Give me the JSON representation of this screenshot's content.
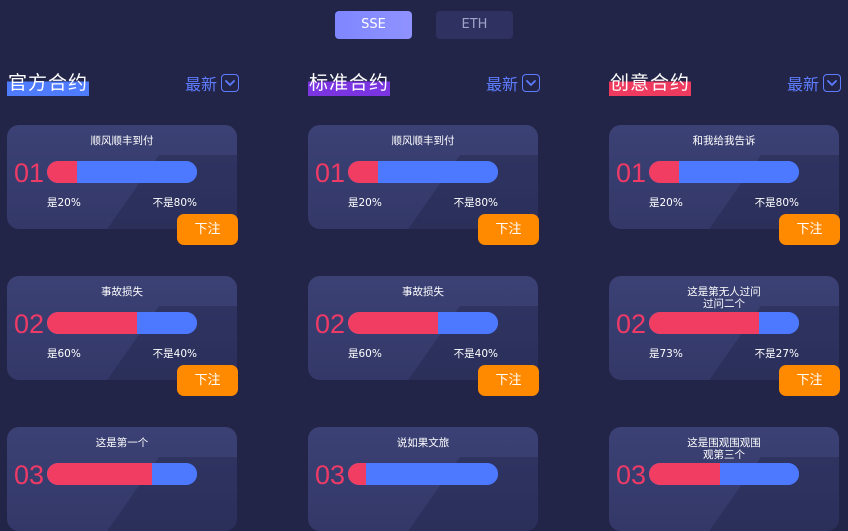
{
  "tabs": [
    {
      "label": "SSE",
      "active": true
    },
    {
      "label": "ETH",
      "active": false
    }
  ],
  "colors": {
    "background": "#232548",
    "tab_active": "#8289ff",
    "accent_blue": "#5d7cff",
    "yes_red": "#f23d63",
    "no_blue": "#4c79ff",
    "button_orange": "#ff8a00",
    "number_pink": "#ee3a66"
  },
  "columns": [
    {
      "title": "官方合约",
      "sort_label": "最新",
      "sort_icon": "chevron-down-icon",
      "cards": [
        {
          "num": "01",
          "title": "顺风顺丰到付",
          "yes_label": "是20%",
          "no_label": "不是80%",
          "yes_percent": 20,
          "button": "下注"
        },
        {
          "num": "02",
          "title": "事故损失",
          "yes_label": "是60%",
          "no_label": "不是40%",
          "yes_percent": 60,
          "button": "下注"
        },
        {
          "num": "03",
          "title": "这是第一个",
          "yes_label": "",
          "no_label": "",
          "yes_percent": 70,
          "button": ""
        }
      ]
    },
    {
      "title": "标准合约",
      "sort_label": "最新",
      "sort_icon": "chevron-down-icon",
      "cards": [
        {
          "num": "01",
          "title": "顺风顺丰到付",
          "yes_label": "是20%",
          "no_label": "不是80%",
          "yes_percent": 20,
          "button": "下注"
        },
        {
          "num": "02",
          "title": "事故损失",
          "yes_label": "是60%",
          "no_label": "不是40%",
          "yes_percent": 60,
          "button": "下注"
        },
        {
          "num": "03",
          "title": "说如果文旅",
          "yes_label": "",
          "no_label": "",
          "yes_percent": 12,
          "button": ""
        }
      ]
    },
    {
      "title": "创意合约",
      "sort_label": "最新",
      "sort_icon": "chevron-down-icon",
      "cards": [
        {
          "num": "01",
          "title": "和我给我告诉",
          "yes_label": "是20%",
          "no_label": "不是80%",
          "yes_percent": 20,
          "button": "下注"
        },
        {
          "num": "02",
          "title": "这是第无人过问\n过问二个",
          "yes_label": "是73%",
          "no_label": "不是27%",
          "yes_percent": 73,
          "button": "下注"
        },
        {
          "num": "03",
          "title": "这是围观围观围\n观第三个",
          "yes_label": "",
          "no_label": "",
          "yes_percent": 47,
          "button": ""
        }
      ]
    }
  ]
}
